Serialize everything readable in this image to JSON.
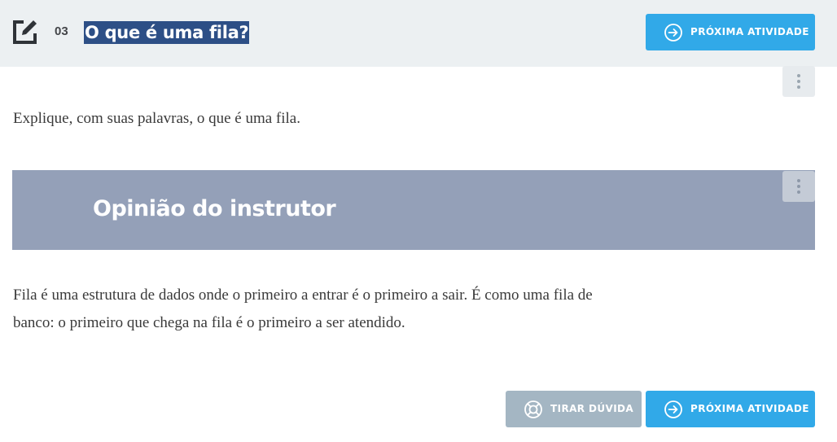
{
  "header": {
    "icon": "edit-icon",
    "task_number": "03",
    "title": "O que é uma fila?",
    "next_button": {
      "label": "PRÓXIMA ATIVIDADE",
      "icon": "arrow-right-circle-icon"
    }
  },
  "content": {
    "question": "Explique, com suas palavras, o que é uma fila.",
    "instructor": {
      "heading": "Opinião do instrutor",
      "answer_line1": "Fila é uma estrutura de dados onde o primeiro a entrar é o primeiro a sair. É como uma fila de",
      "answer_line2": "banco: o primeiro que chega na fila é o primeiro a ser atendido."
    }
  },
  "footer": {
    "doubt_button": {
      "label": "TIRAR DÚVIDA",
      "icon": "lifebuoy-icon"
    },
    "next_button": {
      "label": "PRÓXIMA ATIVIDADE",
      "icon": "arrow-right-circle-icon"
    }
  },
  "colors": {
    "header_bg": "#ecf0f2",
    "primary": "#31a9e8",
    "title_highlight": "#2d4f86",
    "instructor_banner": "#94a0b8",
    "doubt_button": "#a4b6c3"
  }
}
